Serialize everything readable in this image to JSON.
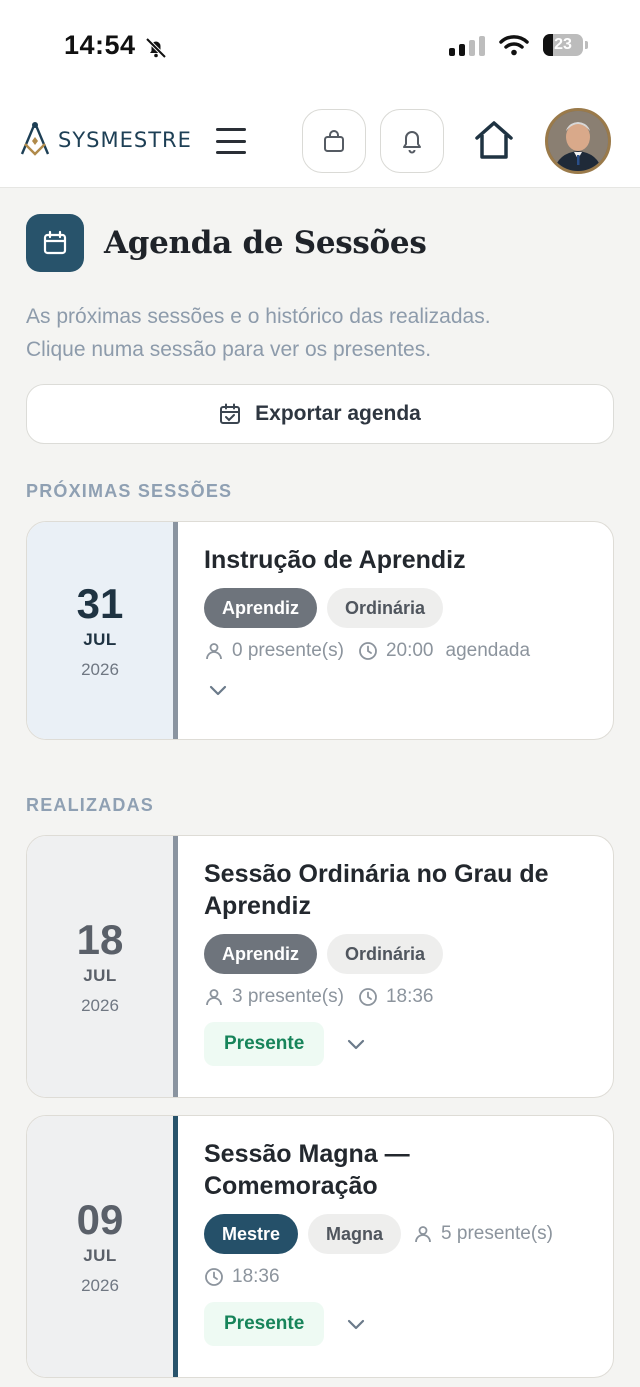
{
  "status_bar": {
    "time": "14:54",
    "battery": "23"
  },
  "header": {
    "logo_text": "SYSMESTRE"
  },
  "page": {
    "title": "Agenda de Sessões",
    "subtitle_line1": "As próximas sessões e o histórico das realizadas.",
    "subtitle_line2": "Clique numa sessão para ver os presentes.",
    "export_label": "Exportar agenda"
  },
  "sections": {
    "upcoming": "PRÓXIMAS SESSÕES",
    "past": "REALIZADAS"
  },
  "sessions": [
    {
      "day": "31",
      "month": "JUL",
      "year": "2026",
      "title": "Instrução de Aprendiz",
      "degree": "Aprendiz",
      "type": "Ordinária",
      "attendees": "0 presente(s)",
      "time": "20:00",
      "state": "agendada"
    },
    {
      "day": "18",
      "month": "JUL",
      "year": "2026",
      "title": "Sessão Ordinária no Grau de Aprendiz",
      "degree": "Aprendiz",
      "type": "Ordinária",
      "attendees": "3 presente(s)",
      "time": "18:36",
      "status": "Presente"
    },
    {
      "day": "09",
      "month": "JUL",
      "year": "2026",
      "title": "Sessão Magna — Comemoração",
      "degree": "Mestre",
      "type": "Magna",
      "attendees": "5 presente(s)",
      "time": "18:36",
      "status": "Presente"
    }
  ],
  "colors": {
    "accent": "#28536b",
    "present": "#17845a",
    "upcoming_date_bg": "#eaf0f6",
    "past_date_bg": "#eff0f1"
  }
}
